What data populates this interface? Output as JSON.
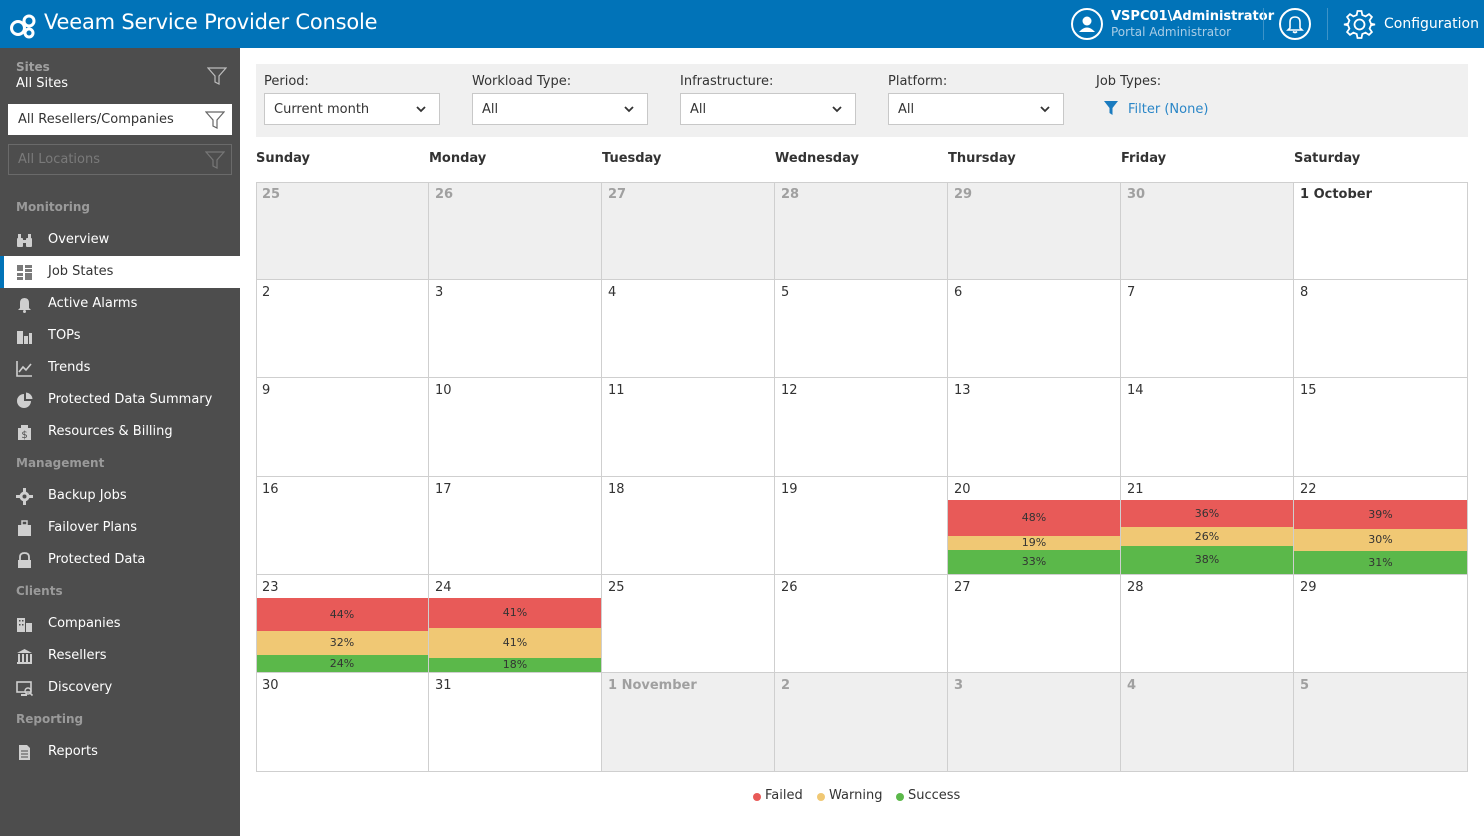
{
  "header": {
    "title": "Veeam Service Provider Console",
    "user_name": "VSPC01\\Administrator",
    "user_role": "Portal Administrator",
    "config_label": "Configuration"
  },
  "sidebar": {
    "sites_label": "Sites",
    "sites_value": "All Sites",
    "resellers_select": "All Resellers/Companies",
    "locations_select": "All Locations",
    "sections": {
      "monitoring": "Monitoring",
      "management": "Management",
      "clients": "Clients",
      "reporting": "Reporting"
    },
    "items": [
      {
        "label": "Overview",
        "icon": "binoculars-icon"
      },
      {
        "label": "Job States",
        "icon": "job-states-icon"
      },
      {
        "label": "Active Alarms",
        "icon": "bell-icon"
      },
      {
        "label": "TOPs",
        "icon": "tops-icon"
      },
      {
        "label": "Trends",
        "icon": "trends-icon"
      },
      {
        "label": "Protected Data Summary",
        "icon": "pie-chart-icon"
      },
      {
        "label": "Resources & Billing",
        "icon": "billing-icon"
      },
      {
        "label": "Backup Jobs",
        "icon": "backup-jobs-icon"
      },
      {
        "label": "Failover Plans",
        "icon": "failover-icon"
      },
      {
        "label": "Protected Data",
        "icon": "protected-data-icon"
      },
      {
        "label": "Companies",
        "icon": "companies-icon"
      },
      {
        "label": "Resellers",
        "icon": "resellers-icon"
      },
      {
        "label": "Discovery",
        "icon": "discovery-icon"
      },
      {
        "label": "Reports",
        "icon": "reports-icon"
      }
    ],
    "active_item": "Job States"
  },
  "filters": {
    "period": {
      "label": "Period:",
      "value": "Current month"
    },
    "workload": {
      "label": "Workload Type:",
      "value": "All"
    },
    "infrastructure": {
      "label": "Infrastructure:",
      "value": "All"
    },
    "platform": {
      "label": "Platform:",
      "value": "All"
    },
    "job_types": {
      "label": "Job Types:",
      "link": "Filter (None)"
    }
  },
  "calendar": {
    "weekdays": [
      "Sunday",
      "Monday",
      "Tuesday",
      "Wednesday",
      "Thursday",
      "Friday",
      "Saturday"
    ],
    "weeks": [
      [
        {
          "d": "25",
          "o": true
        },
        {
          "d": "26",
          "o": true
        },
        {
          "d": "27",
          "o": true
        },
        {
          "d": "28",
          "o": true
        },
        {
          "d": "29",
          "o": true
        },
        {
          "d": "30",
          "o": true
        },
        {
          "d": "1 October",
          "o": false,
          "strong": true
        }
      ],
      [
        {
          "d": "2"
        },
        {
          "d": "3"
        },
        {
          "d": "4"
        },
        {
          "d": "5"
        },
        {
          "d": "6"
        },
        {
          "d": "7"
        },
        {
          "d": "8"
        }
      ],
      [
        {
          "d": "9"
        },
        {
          "d": "10"
        },
        {
          "d": "11"
        },
        {
          "d": "12"
        },
        {
          "d": "13"
        },
        {
          "d": "14"
        },
        {
          "d": "15"
        }
      ],
      [
        {
          "d": "16"
        },
        {
          "d": "17"
        },
        {
          "d": "18"
        },
        {
          "d": "19"
        },
        {
          "d": "20",
          "stats": {
            "failed": "48%",
            "warning": "19%",
            "success": "33%"
          }
        },
        {
          "d": "21",
          "stats": {
            "failed": "36%",
            "warning": "26%",
            "success": "38%"
          }
        },
        {
          "d": "22",
          "stats": {
            "failed": "39%",
            "warning": "30%",
            "success": "31%"
          }
        }
      ],
      [
        {
          "d": "23",
          "stats": {
            "failed": "44%",
            "warning": "32%",
            "success": "24%"
          }
        },
        {
          "d": "24",
          "stats": {
            "failed": "41%",
            "warning": "41%",
            "success": "18%"
          }
        },
        {
          "d": "25"
        },
        {
          "d": "26"
        },
        {
          "d": "27"
        },
        {
          "d": "28"
        },
        {
          "d": "29"
        }
      ],
      [
        {
          "d": "30"
        },
        {
          "d": "31"
        },
        {
          "d": "1 November",
          "o": true
        },
        {
          "d": "2",
          "o": true
        },
        {
          "d": "3",
          "o": true
        },
        {
          "d": "4",
          "o": true
        },
        {
          "d": "5",
          "o": true
        }
      ]
    ]
  },
  "legend": {
    "failed": "Failed",
    "warning": "Warning",
    "success": "Success",
    "colors": {
      "failed": "#e85a58",
      "warning": "#f0c874",
      "success": "#5bb84a"
    }
  }
}
